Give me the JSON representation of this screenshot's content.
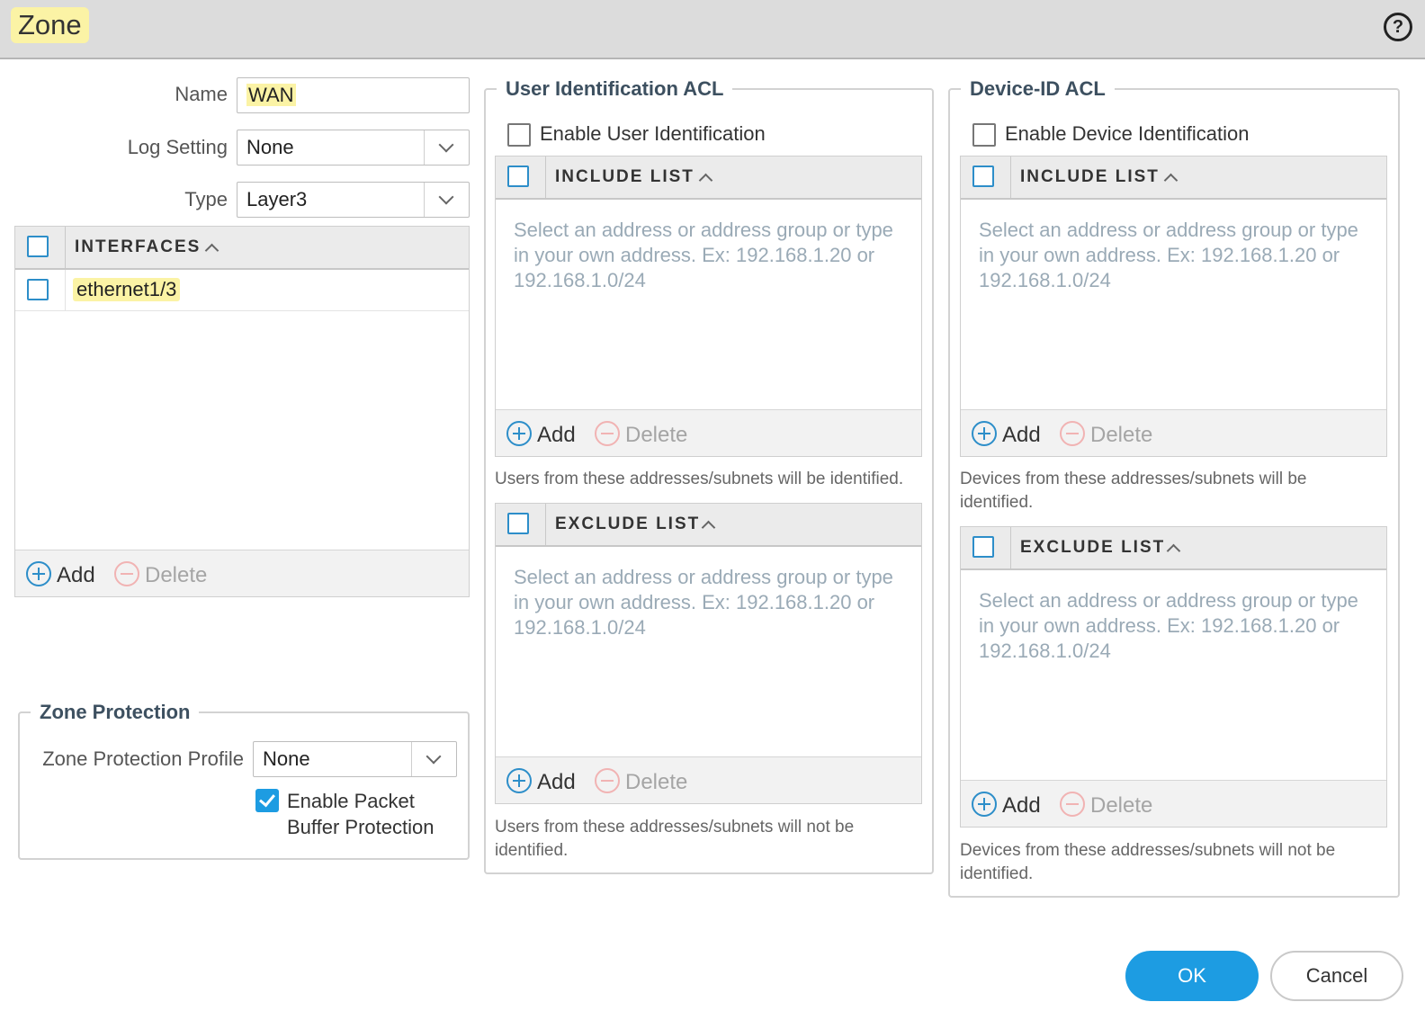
{
  "dialog": {
    "title": "Zone",
    "help_icon": "help-icon",
    "help_glyph": "?"
  },
  "general": {
    "name_label": "Name",
    "name_value": "WAN",
    "log_setting_label": "Log Setting",
    "log_setting_value": "None",
    "type_label": "Type",
    "type_value": "Layer3"
  },
  "interfaces": {
    "header": "INTERFACES",
    "rows": [
      "ethernet1/3"
    ],
    "add_label": "Add",
    "delete_label": "Delete"
  },
  "zone_protection": {
    "legend": "Zone Protection",
    "profile_label": "Zone Protection Profile",
    "profile_value": "None",
    "packet_buffer_label_line1": "Enable Packet",
    "packet_buffer_label_line2": "Buffer Protection",
    "packet_buffer_checked": true
  },
  "user_id_acl": {
    "legend": "User Identification ACL",
    "enable_label": "Enable User Identification",
    "include_header": "INCLUDE LIST",
    "include_placeholder": "Select an address or address group or type in your own address. Ex: 192.168.1.20 or 192.168.1.0/24",
    "include_hint": "Users from these addresses/subnets will be identified.",
    "exclude_header": "EXCLUDE LIST",
    "exclude_placeholder": "Select an address or address group or type in your own address. Ex: 192.168.1.20 or 192.168.1.0/24",
    "exclude_hint": "Users from these addresses/subnets will not be identified.",
    "add_label": "Add",
    "delete_label": "Delete"
  },
  "device_id_acl": {
    "legend": "Device-ID ACL",
    "enable_label": "Enable Device Identification",
    "include_header": "INCLUDE LIST",
    "include_placeholder": "Select an address or address group or type in your own address. Ex: 192.168.1.20 or 192.168.1.0/24",
    "include_hint": "Devices from these addresses/subnets will be identified.",
    "exclude_header": "EXCLUDE LIST",
    "exclude_placeholder": "Select an address or address group or type in your own address. Ex: 192.168.1.20 or 192.168.1.0/24",
    "exclude_hint": "Devices from these addresses/subnets will not be identified.",
    "add_label": "Add",
    "delete_label": "Delete"
  },
  "buttons": {
    "ok": "OK",
    "cancel": "Cancel"
  },
  "colors": {
    "accent": "#1d9ce2",
    "highlight": "#fbf3a5",
    "checkbox_border": "#2d8ec9"
  }
}
